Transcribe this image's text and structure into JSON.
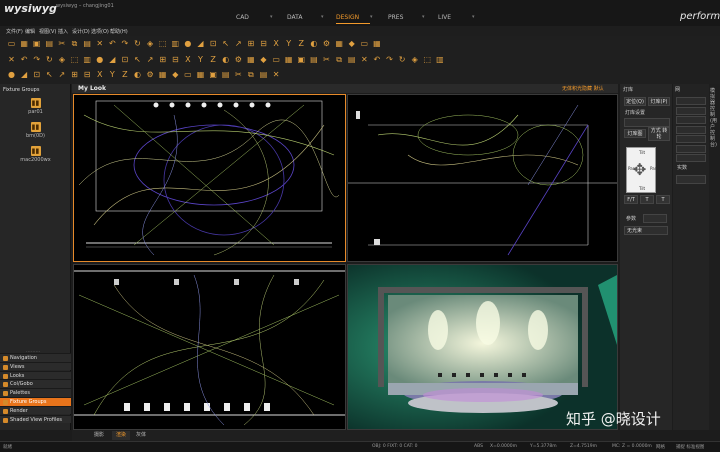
{
  "app": {
    "logo": "wysiwyg",
    "window_title": "wysiwyg – changjing01",
    "brand": "perform"
  },
  "modes": [
    {
      "label": "CAD",
      "active": false
    },
    {
      "label": "DATA",
      "active": false
    },
    {
      "label": "DESIGN",
      "active": true
    },
    {
      "label": "PRES",
      "active": false
    },
    {
      "label": "LIVE",
      "active": false
    }
  ],
  "menus": [
    "文件(F)",
    "编辑",
    "视图(V)",
    "插入",
    "设计(D)",
    "选项(O)",
    "帮助(H)"
  ],
  "left_panel": {
    "title": "Fixture Groups",
    "groups": [
      {
        "label": "par01"
      },
      {
        "label": "bm(0D)"
      },
      {
        "label": "mac2000wx"
      }
    ],
    "nav_items": [
      {
        "label": "Navigation",
        "active": false
      },
      {
        "label": "Views",
        "active": false
      },
      {
        "label": "Looks",
        "active": false
      },
      {
        "label": "Col/Gobo",
        "active": false
      },
      {
        "label": "Palettes",
        "active": false
      },
      {
        "label": "Fixture Groups",
        "active": true
      },
      {
        "label": "Render",
        "active": false
      },
      {
        "label": "Shaded View Profiles",
        "active": false
      }
    ]
  },
  "view": {
    "title": "My Look",
    "extra": "无体积光隐藏 默认"
  },
  "right_panel": {
    "title": "灯库",
    "btn_position": "定位(Q)",
    "btn_palette": "灯库(P)",
    "label_palette": "灯库设置",
    "btn_flip": "灯库图",
    "btn_flip2": "方式 转轮",
    "compass": {
      "top": "Tilt",
      "bottom": "Tilt",
      "left": "Pan",
      "right": "Pan"
    },
    "btn_ft": "F/T",
    "btn_t1": "T",
    "btn_t2": "T",
    "label_param": "参数",
    "label_none": "无光束"
  },
  "right_panel2": {
    "title": "网",
    "label_param": "实数",
    "side_label": "模拟器控制(用户控制台)"
  },
  "tabs": [
    {
      "label": "摄影",
      "active": false
    },
    {
      "label": "渲染",
      "active": true
    },
    {
      "label": "灰体",
      "active": false
    }
  ],
  "status": {
    "left": "就绪",
    "mid": "OBJ: 0 FIXT: 0 CAT: 0",
    "abs": "ABS",
    "x": "X=0.0000m",
    "y": "Y=5.3778m",
    "z": "Z=4.7519m",
    "mc": "MC: Z = 0.0000m",
    "grid": "网格",
    "unit": "捕捉 标准视图"
  },
  "watermark": "知乎 @晓设计",
  "colors": {
    "accent": "#f39a2b",
    "active_nav": "#e8741b",
    "icon": "#e0a040"
  }
}
